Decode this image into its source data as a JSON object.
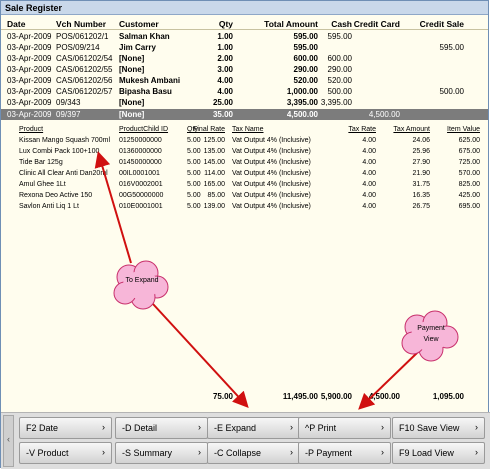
{
  "window": {
    "title": "Sale Register"
  },
  "columns": [
    "Date",
    "Vch Number",
    "Customer",
    "Qty",
    "Total Amount",
    "Cash",
    "Credit Card",
    "Credit Sale"
  ],
  "rows": [
    {
      "date": "03-Apr-2009",
      "vch": "POS/061202/1",
      "customer": "Salman Khan",
      "qty": "1.00",
      "amount": "595.00",
      "cash": "595.00",
      "credit_card": "",
      "credit_sale": ""
    },
    {
      "date": "03-Apr-2009",
      "vch": "POS/09/214",
      "customer": "Jim Carry",
      "qty": "1.00",
      "amount": "595.00",
      "cash": "",
      "credit_card": "",
      "credit_sale": "595.00"
    },
    {
      "date": "03-Apr-2009",
      "vch": "CAS/061202/54",
      "customer": "[None]",
      "qty": "2.00",
      "amount": "600.00",
      "cash": "600.00",
      "credit_card": "",
      "credit_sale": ""
    },
    {
      "date": "03-Apr-2009",
      "vch": "CAS/061202/55",
      "customer": "[None]",
      "qty": "3.00",
      "amount": "290.00",
      "cash": "290.00",
      "credit_card": "",
      "credit_sale": ""
    },
    {
      "date": "03-Apr-2009",
      "vch": "CAS/061202/56",
      "customer": "Mukesh Ambani",
      "qty": "4.00",
      "amount": "520.00",
      "cash": "520.00",
      "credit_card": "",
      "credit_sale": ""
    },
    {
      "date": "03-Apr-2009",
      "vch": "CAS/061202/57",
      "customer": "Bipasha Basu",
      "qty": "4.00",
      "amount": "1,000.00",
      "cash": "500.00",
      "credit_card": "",
      "credit_sale": "500.00"
    },
    {
      "date": "03-Apr-2009",
      "vch": "09/343",
      "customer": "[None]",
      "qty": "25.00",
      "amount": "3,395.00",
      "cash": "3,395.00",
      "credit_card": "",
      "credit_sale": ""
    },
    {
      "date": "03-Apr-2009",
      "vch": "09/397",
      "customer": "[None]",
      "qty": "35.00",
      "amount": "4,500.00",
      "cash": "",
      "credit_card": "4,500.00",
      "credit_sale": ""
    }
  ],
  "detail_columns": [
    "Product",
    "ProductChild ID",
    "Qty",
    "Final Rate",
    "Tax Name",
    "Tax Rate",
    "Tax Amount",
    "Item Value"
  ],
  "detail_rows": [
    {
      "product": "Kissan Mango Squash 700ml",
      "pid": "01250000000",
      "qty": "5.00",
      "rate": "125.00",
      "tax": "Vat Output 4% (Inclusive)",
      "trate": "4.00",
      "tamt": "24.06",
      "ival": "625.00"
    },
    {
      "product": "Lux Combi Pack 100+100",
      "pid": "01360000000",
      "qty": "5.00",
      "rate": "135.00",
      "tax": "Vat Output 4% (Inclusive)",
      "trate": "4.00",
      "tamt": "25.96",
      "ival": "675.00"
    },
    {
      "product": "Tide Bar 125g",
      "pid": "01450000000",
      "qty": "5.00",
      "rate": "145.00",
      "tax": "Vat Output 4% (Inclusive)",
      "trate": "4.00",
      "tamt": "27.90",
      "ival": "725.00"
    },
    {
      "product": "Clinic All Clear Anti Dan20ml",
      "pid": "00IL0001001",
      "qty": "5.00",
      "rate": "114.00",
      "tax": "Vat Output 4% (Inclusive)",
      "trate": "4.00",
      "tamt": "21.90",
      "ival": "570.00"
    },
    {
      "product": "Amul Ghee 1Lt",
      "pid": "016V0002001",
      "qty": "5.00",
      "rate": "165.00",
      "tax": "Vat Output 4% (Inclusive)",
      "trate": "4.00",
      "tamt": "31.75",
      "ival": "825.00"
    },
    {
      "product": "Rexona Deo Active 150",
      "pid": "00G50000000",
      "qty": "5.00",
      "rate": "85.00",
      "tax": "Vat Output 4% (Inclusive)",
      "trate": "4.00",
      "tamt": "16.35",
      "ival": "425.00"
    },
    {
      "product": "Savlon Anti Liq 1 Lt",
      "pid": "010E0001001",
      "qty": "5.00",
      "rate": "139.00",
      "tax": "Vat Output 4% (Inclusive)",
      "trate": "4.00",
      "tamt": "26.75",
      "ival": "695.00"
    }
  ],
  "totals": {
    "qty": "75.00",
    "amount": "11,495.00",
    "cash": "5,900.00",
    "credit_card": "4,500.00",
    "credit_sale": "1,095.00"
  },
  "buttons": [
    [
      "F2 Date",
      "-D Detail",
      "-E Expand",
      "^P Print",
      "F10 Save View"
    ],
    [
      "-V Product",
      "-S Summary",
      "-C Collapse",
      "-P Payment",
      "F9 Load View"
    ]
  ],
  "annotations": {
    "expand": "To Expand",
    "payment_line1": "Payment",
    "payment_line2": "View"
  },
  "colors": {
    "background": "#fffdee",
    "selected_row": "#7c7c7c",
    "arrow": "#d01010",
    "cloud": "#f7b6d8"
  }
}
